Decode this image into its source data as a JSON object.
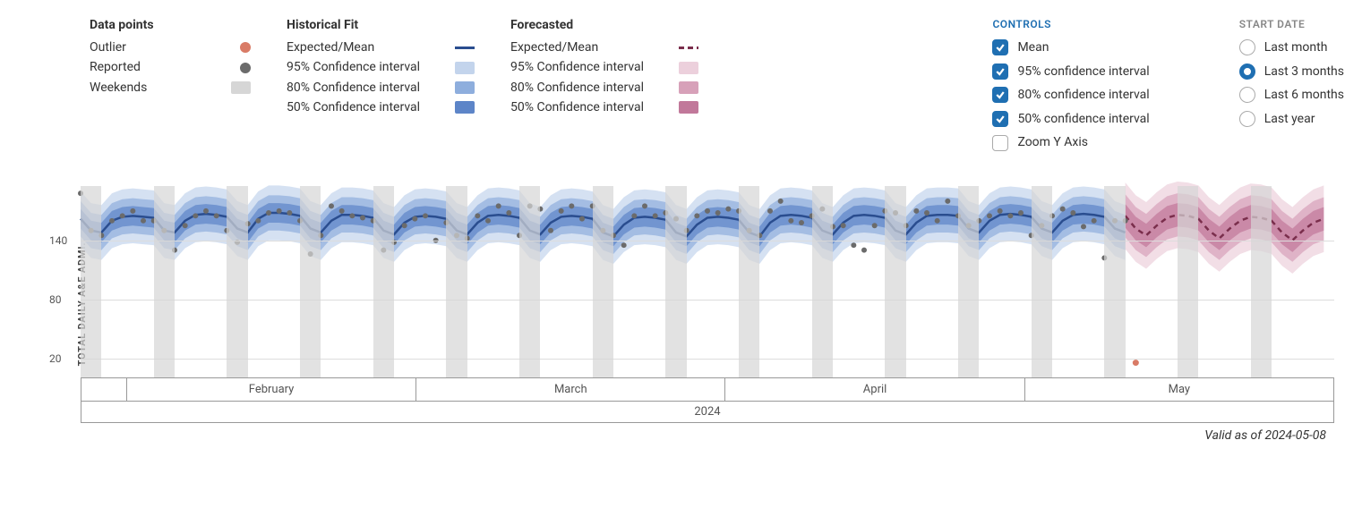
{
  "legend": {
    "data_points": {
      "title": "Data points",
      "items": [
        {
          "label": "Outlier",
          "type": "dot",
          "color": "#d97b66"
        },
        {
          "label": "Reported",
          "type": "dot",
          "color": "#6b6b6b"
        },
        {
          "label": "Weekends",
          "type": "rect",
          "color": "#d6d6d6"
        }
      ]
    },
    "historical": {
      "title": "Historical Fit",
      "items": [
        {
          "label": "Expected/Mean",
          "type": "line",
          "color": "#2a4d8f"
        },
        {
          "label": "95% Confidence interval",
          "type": "rect",
          "color": "#c3d4ec"
        },
        {
          "label": "80% Confidence interval",
          "type": "rect",
          "color": "#8eaedd"
        },
        {
          "label": "50% Confidence interval",
          "type": "rect",
          "color": "#5d85c8"
        }
      ]
    },
    "forecasted": {
      "title": "Forecasted",
      "items": [
        {
          "label": "Expected/Mean",
          "type": "dashed",
          "color": "#7a2e4c"
        },
        {
          "label": "95% Confidence interval",
          "type": "rect",
          "color": "#ecd0dc"
        },
        {
          "label": "80% Confidence interval",
          "type": "rect",
          "color": "#d7a1b9"
        },
        {
          "label": "50% Confidence interval",
          "type": "rect",
          "color": "#c1789a"
        }
      ]
    }
  },
  "controls": {
    "title": "CONTROLS",
    "items": [
      {
        "label": "Mean",
        "checked": true
      },
      {
        "label": "95% confidence interval",
        "checked": true
      },
      {
        "label": "80% confidence interval",
        "checked": true
      },
      {
        "label": "50% confidence interval",
        "checked": true
      },
      {
        "label": "Zoom Y Axis",
        "checked": false
      }
    ]
  },
  "start_date": {
    "title": "START DATE",
    "items": [
      {
        "label": "Last month",
        "selected": false
      },
      {
        "label": "Last 3 months",
        "selected": true
      },
      {
        "label": "Last 6 months",
        "selected": false
      },
      {
        "label": "Last year",
        "selected": false
      }
    ]
  },
  "y_axis_title": "TOTAL DAILY A&E ADMI..",
  "x_axis": {
    "months": [
      "February",
      "March",
      "April",
      "May"
    ],
    "year": "2024"
  },
  "valid_as_of": "Valid as of 2024-05-08",
  "chart_data": {
    "type": "line",
    "title": "",
    "xlabel": "2024",
    "ylabel": "TOTAL DAILY A&E ADMI..",
    "ylim": [
      0,
      200
    ],
    "yticks": [
      20,
      80,
      140
    ],
    "x_range_days": [
      "2024-01-27",
      "2024-05-21"
    ],
    "weekend_day_indices": [
      0,
      1,
      7,
      8,
      14,
      15,
      21,
      22,
      28,
      29,
      35,
      36,
      42,
      43,
      49,
      50,
      56,
      57,
      63,
      64,
      70,
      71,
      77,
      78,
      84,
      85,
      91,
      92,
      98,
      99,
      105,
      106,
      112,
      113
    ],
    "historical_mean": {
      "color": "#2a4d8f",
      "values": [
        162,
        150,
        148,
        160,
        164,
        165,
        164,
        163,
        150,
        148,
        160,
        166,
        167,
        166,
        164,
        152,
        148,
        162,
        168,
        168,
        167,
        165,
        152,
        148,
        160,
        166,
        166,
        165,
        163,
        150,
        146,
        158,
        164,
        165,
        164,
        162,
        150,
        146,
        158,
        165,
        166,
        165,
        163,
        150,
        146,
        158,
        164,
        165,
        164,
        162,
        148,
        144,
        156,
        163,
        164,
        163,
        161,
        148,
        144,
        156,
        163,
        164,
        163,
        161,
        148,
        144,
        158,
        165,
        166,
        165,
        163,
        150,
        146,
        158,
        165,
        166,
        165,
        163,
        150,
        146,
        158,
        165,
        166,
        166,
        165,
        152,
        148,
        160,
        166,
        167,
        166,
        164,
        152,
        148,
        160,
        166,
        167,
        166,
        164,
        152,
        148
      ]
    },
    "historical_ci": {
      "50": {
        "half_width": 10,
        "color": "#5d85c8"
      },
      "80": {
        "half_width": 18,
        "color": "#8eaedd"
      },
      "95": {
        "half_width": 28,
        "color": "#c3d4ec"
      }
    },
    "forecast_mean": {
      "color": "#7a2e4c",
      "values": [
        165,
        152,
        145,
        155,
        163,
        166,
        165,
        162,
        150,
        142,
        152,
        160,
        164,
        163,
        160,
        148,
        140,
        150,
        158,
        162
      ]
    },
    "forecast_ci": {
      "50": {
        "half_width": 12,
        "color": "#c1789a"
      },
      "80": {
        "half_width": 22,
        "color": "#d7a1b9"
      },
      "95": {
        "half_width": 34,
        "color": "#ecd0dc"
      }
    },
    "reported_points": {
      "color": "#6b6b6b",
      "values": [
        188,
        150,
        145,
        160,
        165,
        170,
        160,
        160,
        150,
        130,
        155,
        165,
        170,
        165,
        150,
        138,
        157,
        160,
        168,
        170,
        168,
        160,
        126,
        145,
        175,
        170,
        165,
        163,
        160,
        130,
        138,
        155,
        162,
        165,
        140,
        158,
        145,
        142,
        165,
        160,
        175,
        168,
        145,
        175,
        172,
        150,
        170,
        175,
        162,
        175,
        150,
        145,
        135,
        165,
        175,
        165,
        168,
        162,
        150,
        165,
        170,
        168,
        172,
        170,
        150,
        145,
        170,
        180,
        160,
        158,
        165,
        172,
        154,
        155,
        135,
        130,
        155,
        170,
        168,
        155,
        170,
        168,
        160,
        180,
        165,
        155,
        160,
        165,
        170,
        165,
        168,
        145,
        155,
        165,
        172,
        168,
        154,
        160,
        122,
        160,
        160
      ]
    },
    "outlier_points": {
      "color": "#d97b66",
      "points": [
        {
          "day_index": 101,
          "value": 15
        }
      ]
    }
  }
}
